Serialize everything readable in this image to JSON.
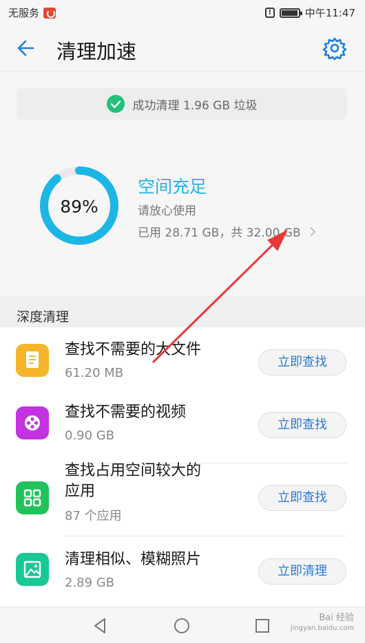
{
  "status_bar": {
    "carrier": "无服务",
    "time": "中午11:47",
    "icons": [
      "carrier-icon",
      "alert-icon",
      "battery-icon"
    ]
  },
  "app_bar": {
    "title": "清理加速",
    "back_icon": "back-arrow-icon",
    "settings_icon": "gear-icon"
  },
  "banner": {
    "text": "成功清理 1.96 GB 垃圾"
  },
  "storage": {
    "percent": "89%",
    "percent_value": 0.89,
    "status": "空间充足",
    "hint": "请放心使用",
    "usage": "已用 28.71 GB，共 32.00 GB"
  },
  "deep_clean": {
    "title": "深度清理",
    "items": [
      {
        "title": "查找不需要的大文件",
        "subtitle": "61.20 MB",
        "button": "立即查找",
        "icon": "document-icon",
        "color": "#f7b52c"
      },
      {
        "title": "查找不需要的视频",
        "subtitle": "0.90 GB",
        "button": "立即查找",
        "icon": "film-reel-icon",
        "color": "#c333e0"
      },
      {
        "title_line1": "查找占用空间较大的",
        "title_line2": "应用",
        "subtitle": "87 个应用",
        "button": "立即查找",
        "icon": "apps-grid-icon",
        "color": "#22c25a"
      },
      {
        "title": "清理相似、模糊照片",
        "subtitle": "2.89 GB",
        "button": "立即清理",
        "icon": "photo-icon",
        "color": "#18c996"
      }
    ]
  },
  "nav": {
    "icons": [
      "back-triangle-icon",
      "home-circle-icon",
      "recents-square-icon"
    ]
  },
  "watermark": {
    "line1": "Bai 经验",
    "line2": "jingyan.baidu.com"
  },
  "colors": {
    "accent": "#1cb6e6",
    "link": "#2a7ad4",
    "success": "#1fc17b",
    "annotation": "#e8383a"
  }
}
